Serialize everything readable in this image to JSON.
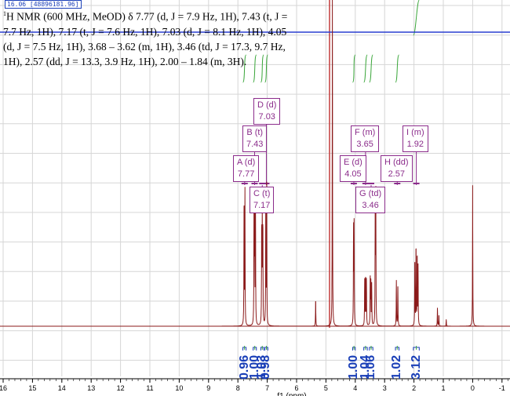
{
  "cursor_readout": "16.06 [48896181.96]",
  "description": {
    "nucleus_sup": "1",
    "text": "H NMR (600 MHz, MeOD) δ 7.77 (d, J = 7.9 Hz, 1H), 7.43 (t, J = 7.7 Hz, 1H), 7.17 (t, J = 7.6 Hz, 1H), 7.03 (d, J = 8.1 Hz, 1H), 4.05 (d, J = 7.5 Hz, 1H), 3.68 – 3.62 (m, 1H), 3.46 (td, J = 17.3, 9.7 Hz, 1H), 2.57 (dd, J = 13.3, 3.9 Hz, 1H), 2.00 – 1.84 (m, 3H)."
  },
  "multiplets": [
    {
      "id": "A",
      "mult": "d",
      "shift": "7.77"
    },
    {
      "id": "B",
      "mult": "t",
      "shift": "7.43"
    },
    {
      "id": "C",
      "mult": "t",
      "shift": "7.17"
    },
    {
      "id": "D",
      "mult": "d",
      "shift": "7.03"
    },
    {
      "id": "E",
      "mult": "d",
      "shift": "4.05"
    },
    {
      "id": "F",
      "mult": "m",
      "shift": "3.65"
    },
    {
      "id": "G",
      "mult": "td",
      "shift": "3.46"
    },
    {
      "id": "H",
      "mult": "dd",
      "shift": "2.57"
    },
    {
      "id": "I",
      "mult": "m",
      "shift": "1.92"
    }
  ],
  "integrals": [
    "0.96",
    "1.00",
    "1.03",
    "0.98",
    "1.00",
    "1.04",
    "1.06",
    "1.02",
    "3.12"
  ],
  "chart_data": {
    "type": "line",
    "xlim": [
      16,
      -1.5
    ],
    "x_ticks": [
      "16",
      "15",
      "14",
      "13",
      "12",
      "11",
      "10",
      "9",
      "8",
      "7",
      "6",
      "5",
      "4",
      "3",
      "2",
      "1",
      "0",
      "-1"
    ],
    "xlabel": "f1 (ppm)",
    "grid": true,
    "peaks": [
      {
        "ppm": 7.79,
        "h": 0.56
      },
      {
        "ppm": 7.76,
        "h": 0.59
      },
      {
        "ppm": 7.45,
        "h": 0.53
      },
      {
        "ppm": 7.43,
        "h": 0.58
      },
      {
        "ppm": 7.4,
        "h": 0.52
      },
      {
        "ppm": 7.19,
        "h": 0.43
      },
      {
        "ppm": 7.17,
        "h": 0.47
      },
      {
        "ppm": 7.15,
        "h": 0.43
      },
      {
        "ppm": 7.05,
        "h": 0.59
      },
      {
        "ppm": 7.02,
        "h": 0.61
      },
      {
        "ppm": 5.35,
        "h": 0.12
      },
      {
        "ppm": 4.78,
        "h": 1.45
      },
      {
        "ppm": 4.06,
        "h": 0.42
      },
      {
        "ppm": 4.04,
        "h": 0.44
      },
      {
        "ppm": 3.68,
        "h": 0.2
      },
      {
        "ppm": 3.65,
        "h": 0.22
      },
      {
        "ppm": 3.62,
        "h": 0.2
      },
      {
        "ppm": 3.49,
        "h": 0.22
      },
      {
        "ppm": 3.47,
        "h": 0.2
      },
      {
        "ppm": 3.44,
        "h": 0.18
      },
      {
        "ppm": 3.32,
        "h": 0.55
      },
      {
        "ppm": 3.3,
        "h": 0.57
      },
      {
        "ppm": 2.6,
        "h": 0.2
      },
      {
        "ppm": 2.55,
        "h": 0.19
      },
      {
        "ppm": 1.97,
        "h": 0.3
      },
      {
        "ppm": 1.93,
        "h": 0.36
      },
      {
        "ppm": 1.89,
        "h": 0.32
      },
      {
        "ppm": 1.86,
        "h": 0.26
      },
      {
        "ppm": 1.2,
        "h": 0.08
      },
      {
        "ppm": 1.15,
        "h": 0.05
      },
      {
        "ppm": 0.9,
        "h": 0.03
      },
      {
        "ppm": 0.0,
        "h": 0.62
      }
    ],
    "integral_regions": [
      {
        "from": 7.83,
        "to": 7.72
      },
      {
        "from": 7.48,
        "to": 7.37
      },
      {
        "from": 7.22,
        "to": 7.12
      },
      {
        "from": 7.08,
        "to": 6.98
      },
      {
        "from": 4.09,
        "to": 4.0
      },
      {
        "from": 3.71,
        "to": 3.59
      },
      {
        "from": 3.52,
        "to": 3.4
      },
      {
        "from": 2.63,
        "to": 2.51
      },
      {
        "from": 2.02,
        "to": 1.82
      }
    ]
  }
}
